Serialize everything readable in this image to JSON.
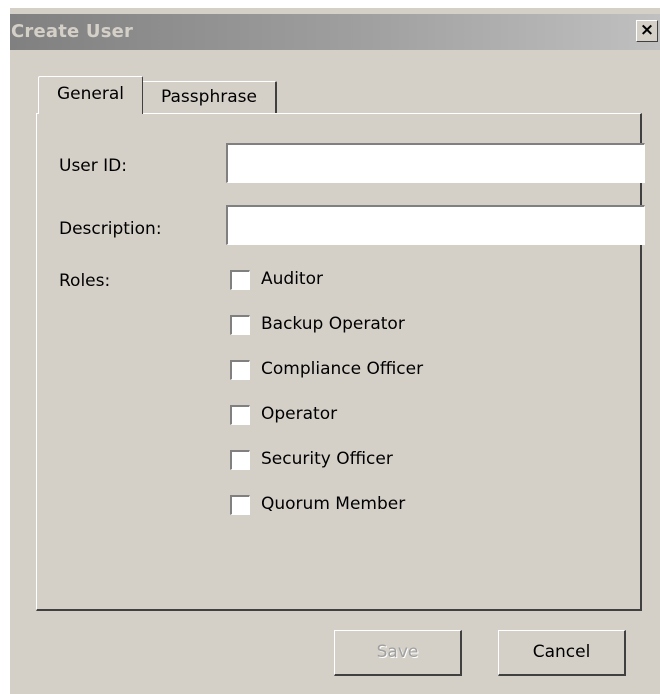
{
  "window": {
    "title": "Create User",
    "close_symbol": "×"
  },
  "tabs": [
    {
      "label": "General",
      "selected": true
    },
    {
      "label": "Passphrase",
      "selected": false
    }
  ],
  "form": {
    "user_id": {
      "label": "User ID:",
      "value": ""
    },
    "description": {
      "label": "Description:",
      "value": ""
    },
    "roles_label": "Roles:",
    "roles": [
      {
        "label": "Auditor",
        "checked": false
      },
      {
        "label": "Backup Operator",
        "checked": false
      },
      {
        "label": "Compliance Officer",
        "checked": false
      },
      {
        "label": "Operator",
        "checked": false
      },
      {
        "label": "Security Officer",
        "checked": false
      },
      {
        "label": "Quorum Member",
        "checked": false
      }
    ]
  },
  "buttons": {
    "save": {
      "label": "Save",
      "enabled": false
    },
    "cancel": {
      "label": "Cancel",
      "enabled": true
    }
  },
  "icons": {
    "close": "close-icon"
  },
  "colors": {
    "dialog_background": "#d4d0c8",
    "titlebar_inactive_start": "#808080",
    "titlebar_inactive_end": "#c0c0c0",
    "disabled_text": "#a0a0a0"
  }
}
